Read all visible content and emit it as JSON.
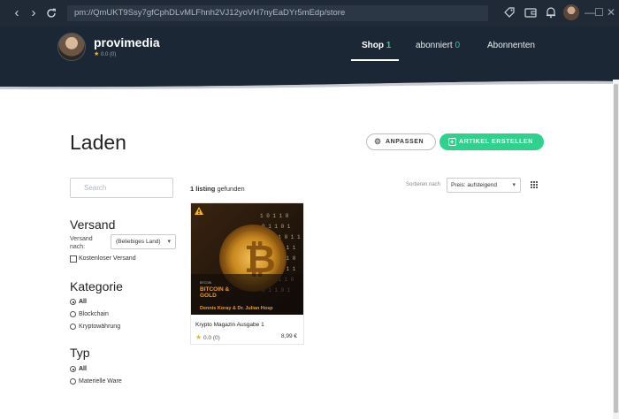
{
  "browser": {
    "address": "pm://QmUKT9Ssy7gfCphDLvMLFhnh2VJ12yoVH7nyEaDYr5mEdp/store"
  },
  "store": {
    "name": "provimedia",
    "rating": "0.0 (0)"
  },
  "tabs": [
    {
      "label": "Shop",
      "count": "1",
      "active": true
    },
    {
      "label": "abonniert",
      "count": "0",
      "active": false
    },
    {
      "label": "Abonnenten",
      "count": "",
      "active": false
    }
  ],
  "page": {
    "title": "Laden",
    "customize_label": "ANPASSEN",
    "create_label": "ARTIKEL ERSTELLEN"
  },
  "search": {
    "placeholder": "Search"
  },
  "filters": {
    "shipping": {
      "title": "Versand",
      "ship_to_label": "Versand nach:",
      "country_value": "(Beliebiges Land)",
      "free_shipping_label": "Kostenloser Versand"
    },
    "category": {
      "title": "Kategorie",
      "options": [
        "All",
        "Blockchain",
        "Kryptowährung"
      ],
      "selected": "All"
    },
    "type": {
      "title": "Typ",
      "options": [
        "All",
        "Materielle Ware"
      ],
      "selected": "All"
    }
  },
  "results": {
    "count_bold": "1 listing",
    "count_rest": "gefunden",
    "sort_label": "Sortieren nach",
    "sort_value": "Preis: aufsteigend"
  },
  "listing": {
    "title": "Krypto Magazin Ausgabe 1",
    "rating": "0.0 (0)",
    "price": "8,99 €",
    "cover": {
      "line1": "BITCOIN &",
      "line2": "GOLD",
      "authors": "Dennis Koray & Dr. Julian Hosp"
    }
  },
  "colors": {
    "header_bg": "#1b2734",
    "accent_green": "#2ed28d",
    "star": "#f0b429"
  }
}
